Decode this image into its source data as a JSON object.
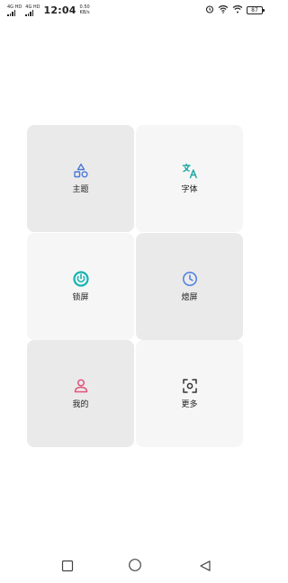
{
  "status_bar": {
    "sim1_label": "4G HD",
    "sim2_label": "4G HD",
    "time": "12:04",
    "speed_value": "0.50",
    "speed_unit": "KB/s",
    "battery": "87"
  },
  "tiles": [
    {
      "label": "主题",
      "icon": "shapes-icon",
      "color": "#4a78d8"
    },
    {
      "label": "字体",
      "icon": "translate-icon",
      "color": "#1aa7a0"
    },
    {
      "label": "锁屏",
      "icon": "lock-dial-icon",
      "color": "#17b3b3"
    },
    {
      "label": "熄屏",
      "icon": "clock-icon",
      "color": "#4a7fe0"
    },
    {
      "label": "我的",
      "icon": "person-icon",
      "color": "#e0557a"
    },
    {
      "label": "更多",
      "icon": "scan-more-icon",
      "color": "#333333"
    }
  ],
  "nav_bar": {
    "recents_icon": "square-icon",
    "home_icon": "circle-icon",
    "back_icon": "triangle-back-icon"
  }
}
